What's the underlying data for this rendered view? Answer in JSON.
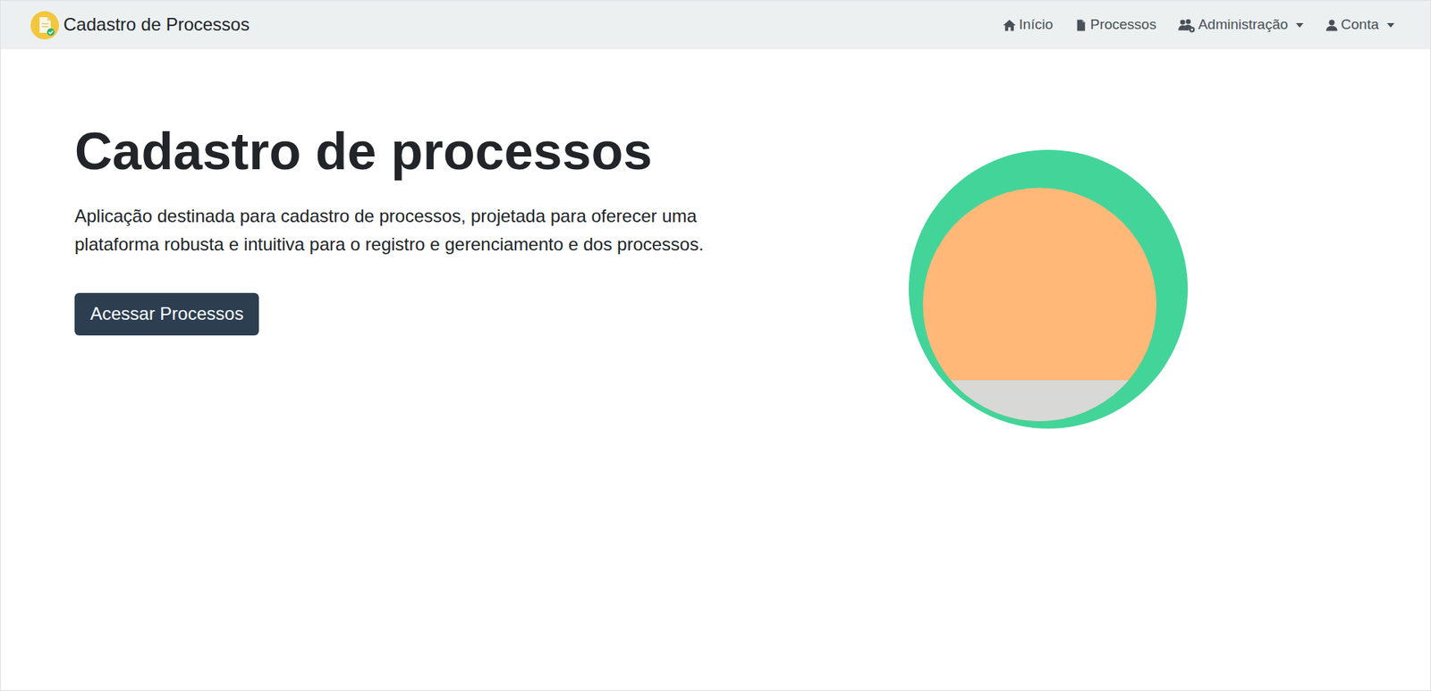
{
  "navbar": {
    "brand": "Cadastro de Processos",
    "items": [
      {
        "label": "Início",
        "icon": "home",
        "dropdown": false
      },
      {
        "label": "Processos",
        "icon": "file",
        "dropdown": false
      },
      {
        "label": "Administração",
        "icon": "users-gear",
        "dropdown": true
      },
      {
        "label": "Conta",
        "icon": "user",
        "dropdown": true
      }
    ]
  },
  "hero": {
    "title": "Cadastro de processos",
    "description": "Aplicação destinada para cadastro de processos, projetada para oferecer uma plataforma robusta e intuitiva para o registro e gerenciamento e dos processos.",
    "button": "Acessar Processos"
  }
}
